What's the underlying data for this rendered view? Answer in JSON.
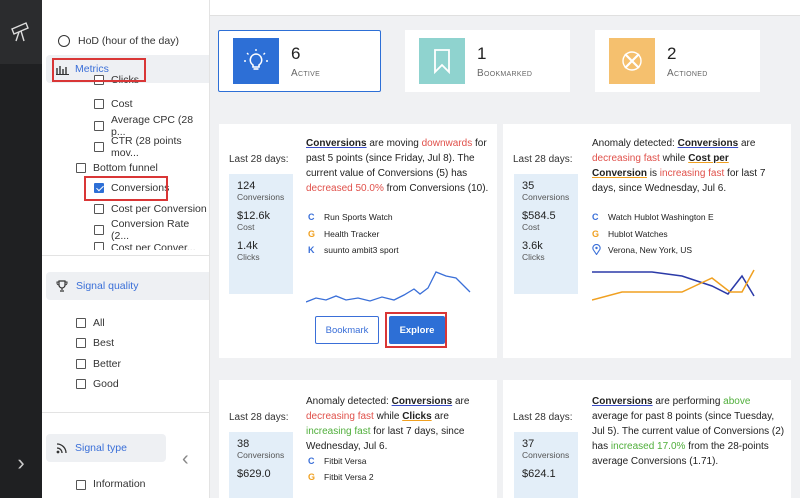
{
  "sidebar": {
    "hod_label": "HoD (hour of the day)",
    "metrics_label": "Metrics",
    "metric_items": [
      "Clicks",
      "Cost",
      "Average CPC (28 p...",
      "CTR (28 points mov..."
    ],
    "bottom_funnel_label": "Bottom funnel",
    "funnel_items": [
      {
        "label": "Conversions",
        "checked": true
      },
      {
        "label": "Cost per Conversion",
        "checked": false
      },
      {
        "label": "Conversion Rate (2...",
        "checked": false
      },
      {
        "label": "Cost per Conver...",
        "checked": false
      }
    ],
    "signal_quality_label": "Signal quality",
    "quality_items": [
      "All",
      "Best",
      "Better",
      "Good"
    ],
    "signal_type_label": "Signal type",
    "type_items": [
      "Information"
    ]
  },
  "stats": [
    {
      "value": "6",
      "label": "Active",
      "color": "#2d6fd6"
    },
    {
      "value": "1",
      "label": "Bookmarked",
      "color": "#8fd3cf"
    },
    {
      "value": "2",
      "label": "Actioned",
      "color": "#f5c06e"
    }
  ],
  "cards": [
    {
      "period": "Last 28 days:",
      "metrics": [
        {
          "value": "124",
          "unit": "Conversions"
        },
        {
          "value": "$12.6k",
          "unit": "Cost"
        },
        {
          "value": "1.4k",
          "unit": "Clicks"
        }
      ],
      "desc": {
        "a": "Conversions",
        "b": " are moving ",
        "c": "downwards",
        "d": " for past 5 points (since Friday, Jul 8). The current value of Conversions (5) has ",
        "e": "decreased 50.0%",
        "f": " from Conversions (10)."
      },
      "sources": [
        {
          "icon": "C",
          "label": "Run Sports Watch"
        },
        {
          "icon": "G",
          "label": "Health Tracker"
        },
        {
          "icon": "K",
          "label": "suunto ambit3 sport"
        }
      ],
      "bookmark_label": "Bookmark",
      "explore_label": "Explore"
    },
    {
      "period": "Last 28 days:",
      "metrics": [
        {
          "value": "35",
          "unit": "Conversions"
        },
        {
          "value": "$584.5",
          "unit": "Cost"
        },
        {
          "value": "3.6k",
          "unit": "Clicks"
        }
      ],
      "desc": {
        "a": "Anomaly detected: ",
        "b": "Conversions",
        "c": " are ",
        "d": "decreasing fast",
        "e": " while ",
        "f": "Cost per Conversion",
        "g": " is ",
        "h": "increasing fast",
        "i": " for last 7 days, since Wednesday, Jul 6."
      },
      "sources": [
        {
          "icon": "C",
          "label": "Watch Hublot Washington E"
        },
        {
          "icon": "G",
          "label": "Hublot Watches"
        },
        {
          "icon": "pin",
          "label": "Verona, New York, US"
        }
      ]
    },
    {
      "period": "Last 28 days:",
      "metrics": [
        {
          "value": "38",
          "unit": "Conversions"
        },
        {
          "value": "$629.0",
          "unit": "Cost"
        }
      ],
      "desc": {
        "a": "Anomaly detected: ",
        "b": "Conversions",
        "c": " are ",
        "d": "decreasing fast",
        "e": " while ",
        "f": "Clicks",
        "g": " are ",
        "h": "increasing fast",
        "i": " for last 7 days, since Wednesday, Jul 6."
      },
      "sources": [
        {
          "icon": "C",
          "label": "Fitbit Versa"
        },
        {
          "icon": "G",
          "label": "Fitbit Versa 2"
        }
      ]
    },
    {
      "period": "Last 28 days:",
      "metrics": [
        {
          "value": "37",
          "unit": "Conversions"
        },
        {
          "value": "$624.1",
          "unit": "Cost"
        }
      ],
      "desc": {
        "a": "Conversions",
        "b": " are performing ",
        "c": "above",
        "d": " average for past 8 points (since Tuesday, Jul 5). The current value of Conversions (2) has ",
        "e": "increased 17.0%",
        "f": " from the 28-points average Conversions (1.71)."
      }
    }
  ]
}
